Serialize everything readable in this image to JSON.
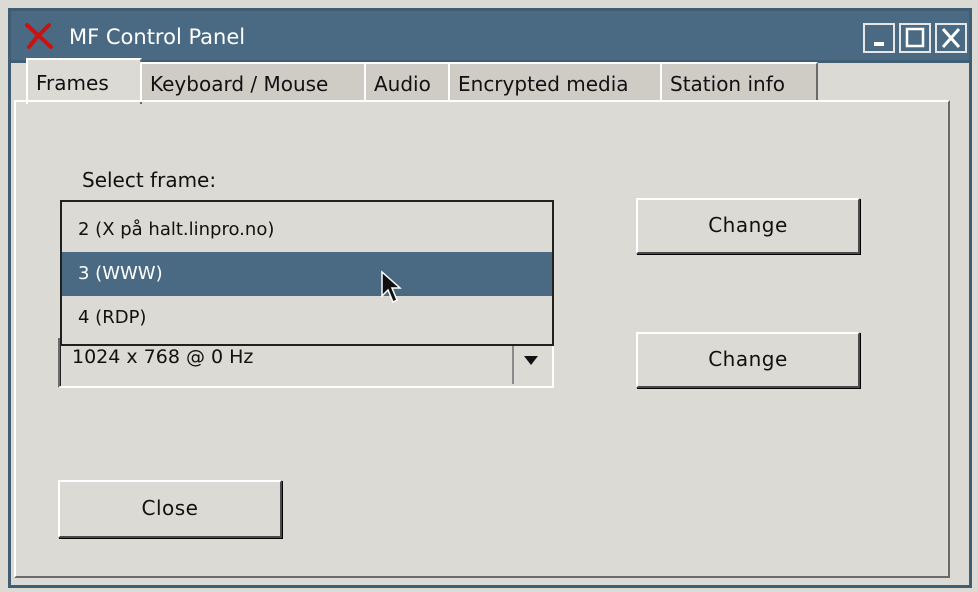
{
  "window": {
    "title": "MF Control Panel"
  },
  "tabs": [
    {
      "label": "Frames",
      "active": true
    },
    {
      "label": "Keyboard / Mouse",
      "active": false
    },
    {
      "label": "Audio",
      "active": false
    },
    {
      "label": "Encrypted media",
      "active": false
    },
    {
      "label": "Station info",
      "active": false
    }
  ],
  "frames": {
    "select_label": "Select frame:",
    "frame_options": [
      "2 (X på halt.linpro.no)",
      "3 (WWW)",
      "4 (RDP)"
    ],
    "selected_frame_index": 1,
    "change_frame_button": "Change",
    "resolution_value": "1024 x 768 @ 0  Hz",
    "change_resolution_button": "Change",
    "close_button": "Close"
  },
  "colors": {
    "titlebar": "#4a6a83",
    "selection": "#4a6a83",
    "panel_bg": "#dcdad5"
  },
  "icons": [
    "app-x-icon",
    "minimize-icon",
    "maximize-icon",
    "close-icon",
    "dropdown-arrow-icon",
    "mouse-pointer-icon"
  ]
}
